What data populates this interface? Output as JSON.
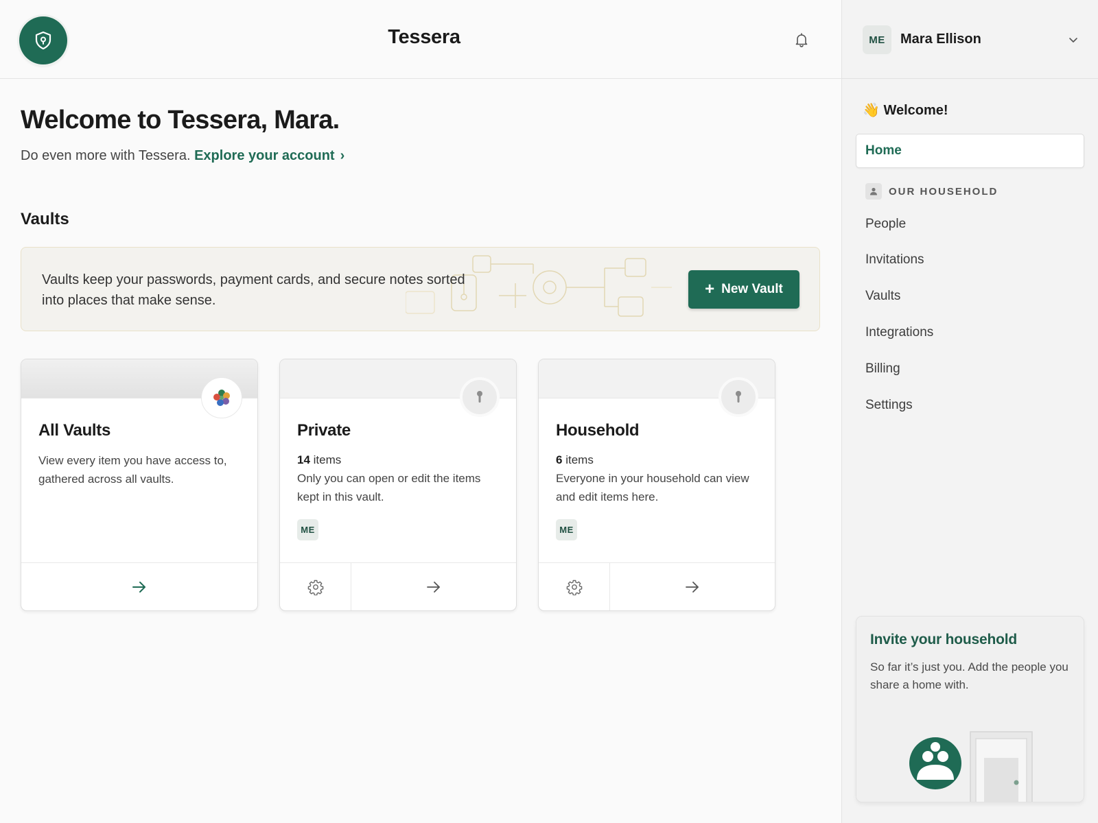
{
  "header": {
    "app_title": "Tessera",
    "logo_icon": "shield-icon",
    "bell_icon": "bell-icon"
  },
  "main": {
    "welcome_heading": "Welcome to Tessera, Mara.",
    "subline_text": "Do even more with Tessera.",
    "subline_link": "Explore your account",
    "subline_chevron": "›",
    "vaults_title": "Vaults",
    "banner_text": "Vaults keep your passwords, payment cards, and secure notes sorted into places that make sense.",
    "new_vault_plus": "+",
    "new_vault_label": "New Vault"
  },
  "cards": [
    {
      "title": "All Vaults",
      "description": "View every item you have access to, gathered across all vaults.",
      "badge_icon": "color-cluster-icon"
    },
    {
      "title": "Private",
      "count": "14",
      "count_label": "items",
      "description": "Only you can open or edit the items kept in this vault.",
      "avatar": "ME",
      "badge_icon": "keyhole-icon"
    },
    {
      "title": "Household",
      "count": "6",
      "count_label": "items",
      "description": "Everyone in your household can view and edit items here.",
      "avatar": "ME",
      "badge_icon": "keyhole-icon"
    }
  ],
  "sidebar": {
    "user_initials": "ME",
    "user_name": "Mara Ellison",
    "welcome_emoji": "👋",
    "welcome_text": "Welcome!",
    "home_label": "Home",
    "group_label": "OUR HOUSEHOLD",
    "items": [
      {
        "label": "People"
      },
      {
        "label": "Invitations"
      },
      {
        "label": "Vaults"
      },
      {
        "label": "Integrations"
      },
      {
        "label": "Billing"
      },
      {
        "label": "Settings"
      }
    ],
    "invite": {
      "title": "Invite your household",
      "description": "So far it’s just you. Add the people you share a home with."
    }
  },
  "colors": {
    "brand_green": "#1f6b55",
    "background": "#fafafa",
    "sidebar_bg": "#f3f3f3"
  }
}
